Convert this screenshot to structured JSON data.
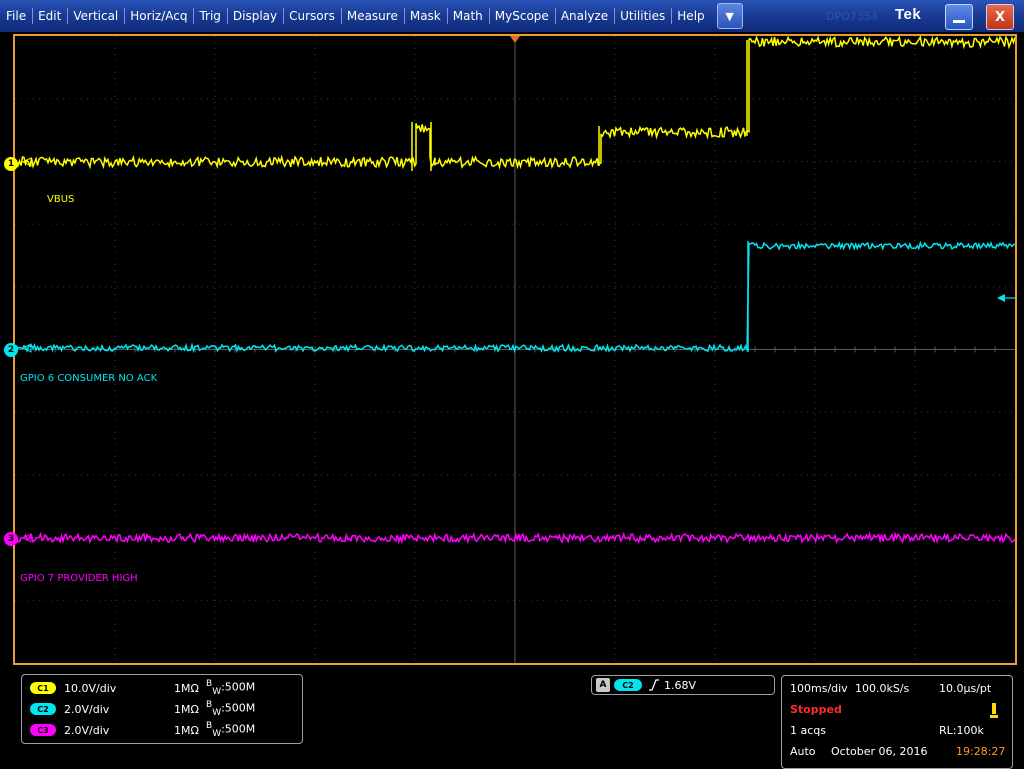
{
  "menu": {
    "items": [
      "File",
      "Edit",
      "Vertical",
      "Horiz/Acq",
      "Trig",
      "Display",
      "Cursors",
      "Measure",
      "Mask",
      "Math",
      "MyScope",
      "Analyze",
      "Utilities",
      "Help"
    ],
    "dropdown_glyph": "▼"
  },
  "titlebar": {
    "brand": "Tek",
    "faint_model": "DPO7354",
    "minimize_icon": "minimize-icon",
    "close_glyph": "X"
  },
  "colors": {
    "ch1": "#ffff00",
    "ch2": "#00e5ee",
    "ch3": "#ff00ff",
    "frame": "#e89b3e",
    "status_red": "#ff2a2a",
    "time_orange": "#ff9a22"
  },
  "waveforms": {
    "ch1": {
      "label": "VBUS",
      "marker": "1",
      "segments_divs": [
        [
          0,
          4.99,
          3.8
        ],
        [
          4.99,
          5.14,
          3.8
        ],
        [
          5.14,
          5.83,
          4.35
        ],
        [
          5.83,
          7.36,
          3.8
        ],
        [
          7.36,
          10,
          4.35
        ]
      ],
      "events_divs": [
        [
          3.98,
          4.14,
          4.35
        ],
        [
          5.83,
          7.36,
          4.35
        ]
      ],
      "description_units": "division coordinates are time(div) and level(div)"
    },
    "ch2": {
      "label": "GPIO 6 CONSUMER NO ACK",
      "marker": "2"
    },
    "ch3": {
      "label": "GPIO 7 PROVIDER HIGH",
      "marker": "3"
    }
  },
  "vertical": {
    "channels": [
      {
        "badge": "C1",
        "scale": "10.0V/div",
        "impedance": "1MΩ",
        "bw_prefix": "B",
        "bw_sub": "W",
        "bw_value": ":500M"
      },
      {
        "badge": "C2",
        "scale": "2.0V/div",
        "impedance": "1MΩ",
        "bw_prefix": "B",
        "bw_sub": "W",
        "bw_value": ":500M"
      },
      {
        "badge": "C3",
        "scale": "2.0V/div",
        "impedance": "1MΩ",
        "bw_prefix": "B",
        "bw_sub": "W",
        "bw_value": ":500M"
      }
    ]
  },
  "trigger": {
    "mode_letter": "A",
    "source": "C2",
    "slope_icon": "rising-edge-icon",
    "level": "1.68V"
  },
  "acquisition": {
    "timebase": "100ms/div",
    "sample_rate": "100.0kS/s",
    "resolution": "10.0μs/pt",
    "state": "Stopped",
    "acqs": "1 acqs",
    "record_length": "RL:100k",
    "trigger_mode": "Auto",
    "date": "October 06, 2016",
    "time": "19:28:27"
  }
}
